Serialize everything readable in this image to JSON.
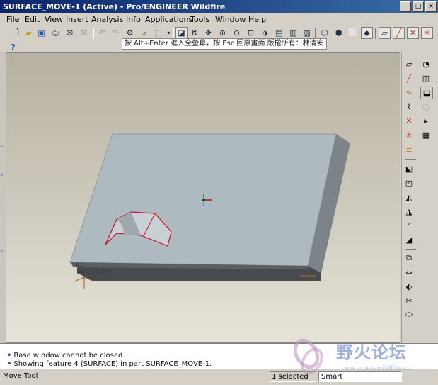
{
  "window": {
    "title": "SURFACE_MOVE-1 (Active) - Pro/ENGINEER Wildfire"
  },
  "menu": [
    "File",
    "Edit",
    "View",
    "Insert",
    "Analysis",
    "Info",
    "Applications",
    "Tools",
    "Window",
    "Help"
  ],
  "hint_text": "按 Alt+Enter 進入全螢幕，按 Esc 回原畫面    版權所有：林清安",
  "help_icon": "?",
  "messages": [
    "Base window cannot be closed.",
    "Showing feature 4 (SURFACE) in part SURFACE_MOVE-1."
  ],
  "status": {
    "tool": "Move Tool",
    "selected": "1 selected",
    "filter": "Smart"
  },
  "watermark": {
    "text": "野火论坛",
    "url": "www.proewildfire.cn"
  },
  "model": {
    "label_left": "A_1",
    "label_right": "A_1",
    "csys_label": "PRT_CSYS_DEF"
  },
  "colors": {
    "surface_edge": "#c8102e",
    "top_face": "#aeb9c0",
    "side_dark": "#474b50",
    "side_right": "#7d8489"
  }
}
